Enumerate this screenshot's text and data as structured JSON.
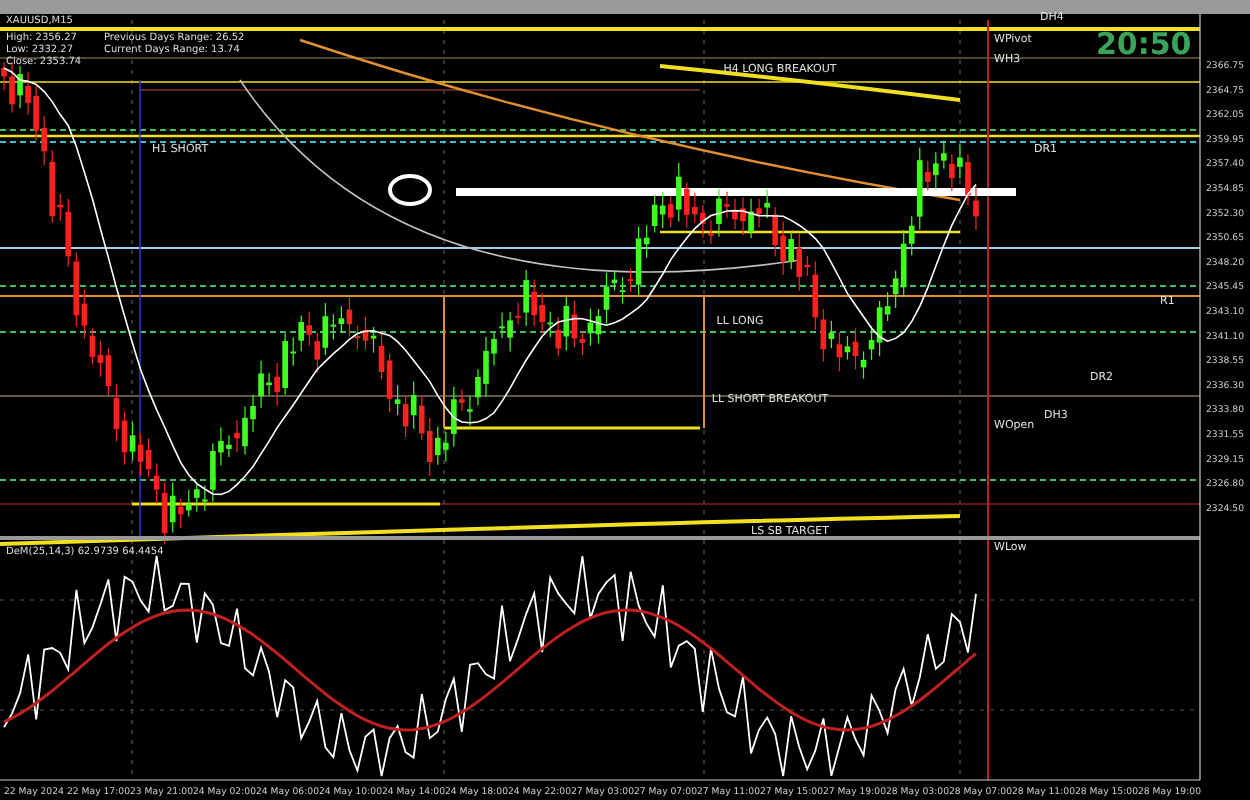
{
  "chart": {
    "symbol": "XAUUSD,M15",
    "info": [
      "High: 2356.27",
      "Low: 2332.27",
      "Close: 2353.74"
    ],
    "ranges": [
      "Previous Days Range: 26.52",
      "Current Days Range: 13.74"
    ],
    "clock": "20:50",
    "level_labels": [
      "H4 LONG BREAKOUT",
      "H1 SHORT",
      "LL LONG",
      "LL SHORT BREAKOUT",
      "LS SB TARGET"
    ],
    "pivot_labels": [
      "DH4",
      "WPivot",
      "WH3",
      "DR1",
      "R1",
      "DR2",
      "DH3",
      "WOpen",
      "WLow"
    ],
    "price_axis": [
      "2366.75",
      "2364.75",
      "2362.05",
      "2359.95",
      "2357.40",
      "2354.85",
      "2352.30",
      "2350.65",
      "2348.20",
      "2345.45",
      "2343.10",
      "2341.10",
      "2338.55",
      "2336.30",
      "2333.80",
      "2331.55",
      "2329.15",
      "2326.80",
      "2324.50"
    ],
    "indicator": "DeM(25,14,3) 62.9739 64.4454",
    "time_axis": [
      "22 May 2024",
      "22 May 17:00",
      "23 May 21:00",
      "24 May 02:00",
      "24 May 06:00",
      "24 May 10:00",
      "24 May 14:00",
      "24 May 18:00",
      "24 May 22:00",
      "27 May 03:00",
      "27 May 07:00",
      "27 May 11:00",
      "27 May 15:00",
      "27 May 19:00",
      "28 May 03:00",
      "28 May 07:00",
      "28 May 11:00",
      "28 May 15:00",
      "28 May 19:00"
    ]
  }
}
